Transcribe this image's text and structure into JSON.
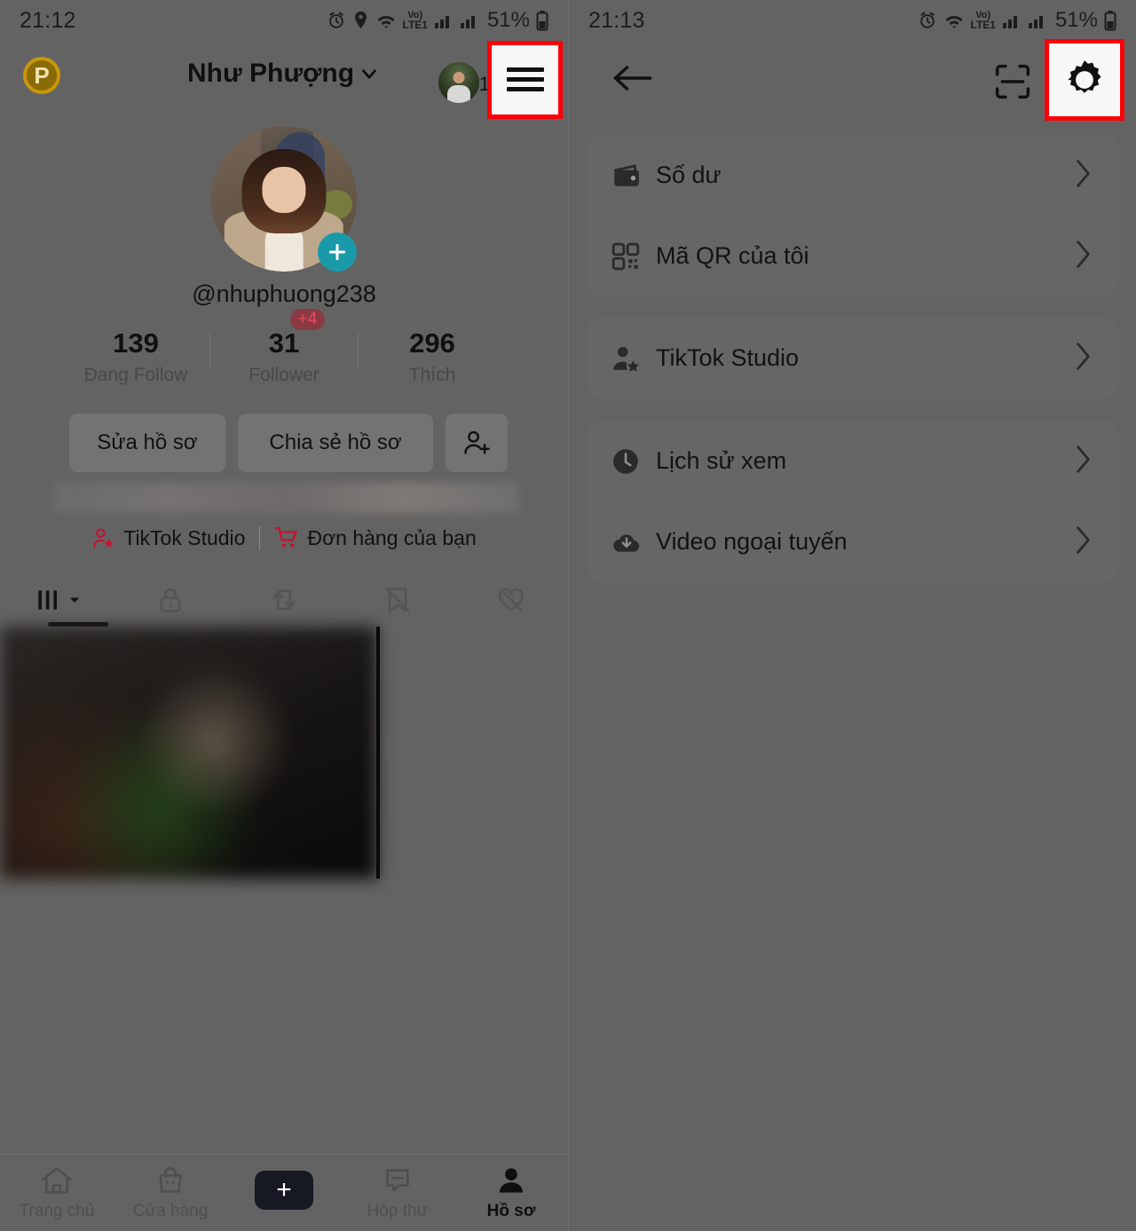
{
  "meta": {
    "bg_color": "#636363",
    "card_color": "#666666",
    "highlight_color": "#fb0007",
    "accent_teal": "#1a9aa8",
    "accent_red": "#e8295b"
  },
  "left": {
    "status_bar": {
      "time": "21:12",
      "battery": "51%",
      "network": "LTE1",
      "volte": "Vo)"
    },
    "header": {
      "title": "Như Phượng",
      "chevron_icon": "chevron-down-icon",
      "coin_label": "P",
      "avatar_count": "1",
      "menu_icon": "hamburger-menu-icon"
    },
    "profile": {
      "handle": "@nhuphuong238",
      "add_story_icon": "plus-circle-icon",
      "stats": [
        {
          "value": "139",
          "label": "Đang Follow",
          "badge": ""
        },
        {
          "value": "31",
          "label": "Follower",
          "badge": "+4"
        },
        {
          "value": "296",
          "label": "Thích",
          "badge": ""
        }
      ],
      "buttons": [
        {
          "label": "Sửa hồ sơ",
          "icon": ""
        },
        {
          "label": "Chia sẻ hồ sơ",
          "icon": ""
        },
        {
          "label": "",
          "icon": "add-person-icon"
        }
      ],
      "quick_links": [
        {
          "label": "TikTok Studio",
          "icon": "person-star-icon"
        },
        {
          "label": "Đơn hàng của bạn",
          "icon": "shopping-cart-icon"
        }
      ],
      "tabs": [
        {
          "icon": "grid-posts-icon",
          "active": true
        },
        {
          "icon": "lock-private-icon",
          "active": false
        },
        {
          "icon": "repost-icon",
          "active": false
        },
        {
          "icon": "saved-bookmark-icon",
          "active": false
        },
        {
          "icon": "liked-heart-icon",
          "active": false
        }
      ]
    },
    "bottom_nav": [
      {
        "label": "Trang chủ",
        "icon": "home-icon",
        "active": false
      },
      {
        "label": "Cửa hàng",
        "icon": "shop-bag-icon",
        "active": false
      },
      {
        "label": "",
        "icon": "create-plus-icon",
        "active": false
      },
      {
        "label": "Hộp thư",
        "icon": "inbox-message-icon",
        "active": false
      },
      {
        "label": "Hồ sơ",
        "icon": "profile-person-icon",
        "active": true
      }
    ]
  },
  "right": {
    "status_bar": {
      "time": "21:13",
      "battery": "51%",
      "network": "LTE1",
      "volte": "Vo)"
    },
    "header": {
      "back_icon": "back-arrow-icon",
      "scan_icon": "qr-scan-icon",
      "settings_icon": "gear-settings-icon"
    },
    "menu_groups": [
      {
        "items": [
          {
            "label": "Số dư",
            "icon": "wallet-icon",
            "chevron": "chevron-right-icon"
          },
          {
            "label": "Mã QR của tôi",
            "icon": "qr-code-icon",
            "chevron": "chevron-right-icon"
          }
        ]
      },
      {
        "items": [
          {
            "label": "TikTok Studio",
            "icon": "person-star-icon",
            "chevron": "chevron-right-icon"
          }
        ]
      },
      {
        "items": [
          {
            "label": "Lịch sử xem",
            "icon": "clock-history-icon",
            "chevron": "chevron-right-icon"
          },
          {
            "label": "Video ngoại tuyến",
            "icon": "download-cloud-icon",
            "chevron": "chevron-right-icon"
          }
        ]
      }
    ]
  }
}
